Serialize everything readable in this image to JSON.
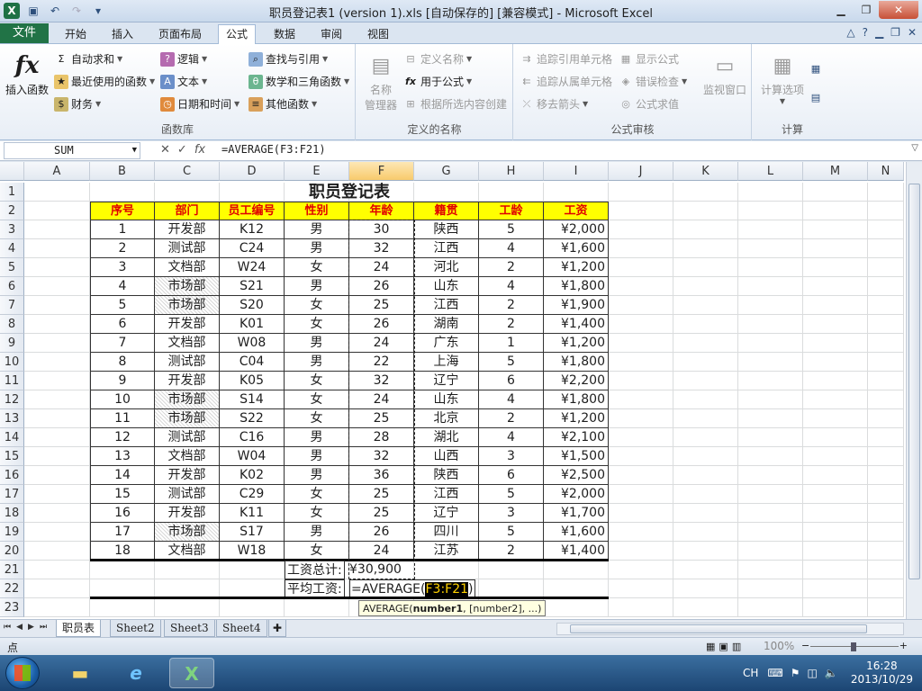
{
  "window": {
    "title": "职员登记表1 (version 1).xls [自动保存的] [兼容模式] - Microsoft Excel"
  },
  "tabs": [
    "文件",
    "开始",
    "插入",
    "页面布局",
    "公式",
    "数据",
    "审阅",
    "视图"
  ],
  "active_tab": "公式",
  "ribbon": {
    "function_library": {
      "label": "函数库",
      "insert_function": "插入函数",
      "autosum": "自动求和",
      "recent": "最近使用的函数",
      "financial": "财务",
      "logical": "逻辑",
      "text": "文本",
      "datetime": "日期和时间",
      "lookup": "查找与引用",
      "math": "数学和三角函数",
      "more": "其他函数"
    },
    "defined_names": {
      "label": "定义的名称",
      "name_manager_1": "名称",
      "name_manager_2": "管理器",
      "define_name": "定义名称",
      "use_in_formula": "用于公式",
      "create_from_selection": "根据所选内容创建"
    },
    "formula_auditing": {
      "label": "公式审核",
      "trace_precedents": "追踪引用单元格",
      "trace_dependents": "追踪从属单元格",
      "remove_arrows": "移去箭头",
      "show_formulas": "显示公式",
      "error_checking": "错误检查",
      "evaluate_formula": "公式求值",
      "watch_window": "监视窗口"
    },
    "calculation": {
      "label": "计算",
      "calc_options": "计算选项"
    }
  },
  "formula_bar": {
    "name_box": "SUM",
    "formula": "=AVERAGE(F3:F21)"
  },
  "columns": [
    "A",
    "B",
    "C",
    "D",
    "E",
    "F",
    "G",
    "H",
    "I",
    "J",
    "K",
    "L",
    "M",
    "N"
  ],
  "rows": [
    "1",
    "2",
    "3",
    "4",
    "5",
    "6",
    "7",
    "8",
    "9",
    "10",
    "11",
    "12",
    "13",
    "14",
    "15",
    "16",
    "17",
    "18",
    "19",
    "20",
    "21",
    "22",
    "23"
  ],
  "sheet": {
    "title": "职员登记表",
    "headers": [
      "序号",
      "部门",
      "员工编号",
      "性别",
      "年龄",
      "籍贯",
      "工龄",
      "工资"
    ],
    "data": [
      [
        "1",
        "开发部",
        "K12",
        "男",
        "30",
        "陕西",
        "5",
        "¥2,000"
      ],
      [
        "2",
        "测试部",
        "C24",
        "男",
        "32",
        "江西",
        "4",
        "¥1,600"
      ],
      [
        "3",
        "文档部",
        "W24",
        "女",
        "24",
        "河北",
        "2",
        "¥1,200"
      ],
      [
        "4",
        "市场部",
        "S21",
        "男",
        "26",
        "山东",
        "4",
        "¥1,800"
      ],
      [
        "5",
        "市场部",
        "S20",
        "女",
        "25",
        "江西",
        "2",
        "¥1,900"
      ],
      [
        "6",
        "开发部",
        "K01",
        "女",
        "26",
        "湖南",
        "2",
        "¥1,400"
      ],
      [
        "7",
        "文档部",
        "W08",
        "男",
        "24",
        "广东",
        "1",
        "¥1,200"
      ],
      [
        "8",
        "测试部",
        "C04",
        "男",
        "22",
        "上海",
        "5",
        "¥1,800"
      ],
      [
        "9",
        "开发部",
        "K05",
        "女",
        "32",
        "辽宁",
        "6",
        "¥2,200"
      ],
      [
        "10",
        "市场部",
        "S14",
        "女",
        "24",
        "山东",
        "4",
        "¥1,800"
      ],
      [
        "11",
        "市场部",
        "S22",
        "女",
        "25",
        "北京",
        "2",
        "¥1,200"
      ],
      [
        "12",
        "测试部",
        "C16",
        "男",
        "28",
        "湖北",
        "4",
        "¥2,100"
      ],
      [
        "13",
        "文档部",
        "W04",
        "男",
        "32",
        "山西",
        "3",
        "¥1,500"
      ],
      [
        "14",
        "开发部",
        "K02",
        "男",
        "36",
        "陕西",
        "6",
        "¥2,500"
      ],
      [
        "15",
        "测试部",
        "C29",
        "女",
        "25",
        "江西",
        "5",
        "¥2,000"
      ],
      [
        "16",
        "开发部",
        "K11",
        "女",
        "25",
        "辽宁",
        "3",
        "¥1,700"
      ],
      [
        "17",
        "市场部",
        "S17",
        "男",
        "26",
        "四川",
        "5",
        "¥1,600"
      ],
      [
        "18",
        "文档部",
        "W18",
        "女",
        "24",
        "江苏",
        "2",
        "¥1,400"
      ]
    ],
    "total_label": "工资总计:",
    "total_value": "¥30,900",
    "avg_label": "平均工资:",
    "avg_formula_prefix": "=AVERAGE(",
    "avg_formula_ref": "F3:F21",
    "avg_formula_suffix": ")"
  },
  "tooltip": {
    "fn": "AVERAGE(",
    "arg1": "number1",
    "rest": ", [number2], ...)"
  },
  "sheet_tabs": [
    "职员表",
    "Sheet2",
    "Sheet3",
    "Sheet4"
  ],
  "status": {
    "mode": "点",
    "zoom": "100%"
  },
  "taskbar": {
    "lang": "CH",
    "time": "16:28",
    "date": "2013/10/29"
  },
  "colors": {
    "header_fill": "#ffff00",
    "header_text": "#e00000",
    "file_tab": "#217346"
  }
}
